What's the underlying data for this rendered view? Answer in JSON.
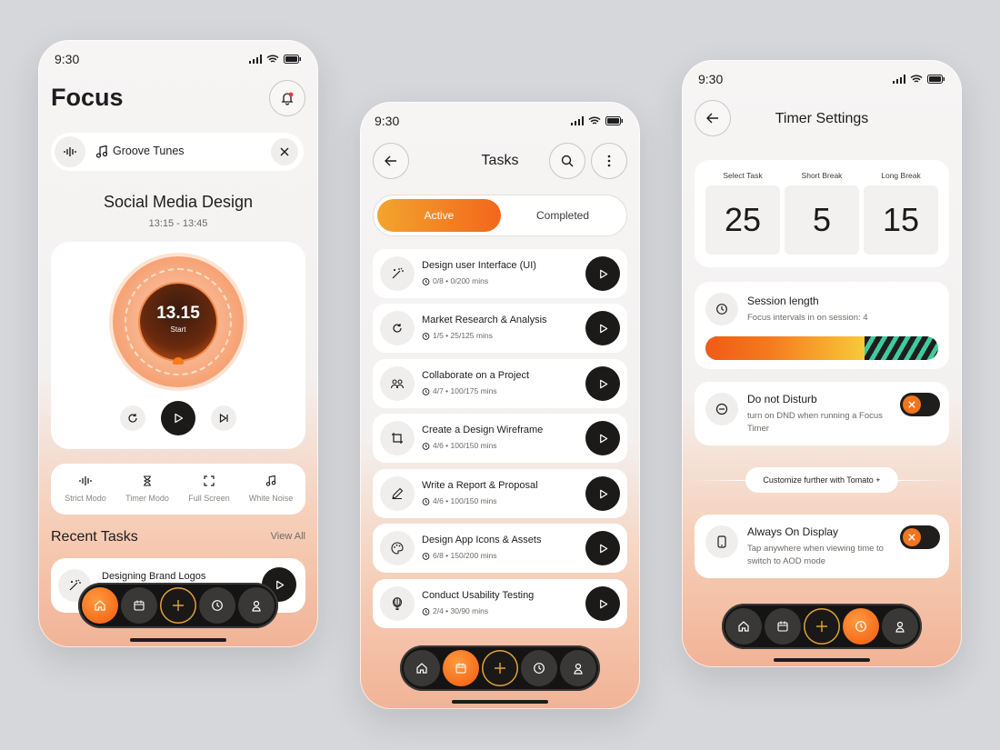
{
  "status_time": "9:30",
  "focus_screen": {
    "title": "Focus",
    "music_label": "Groove Tunes",
    "session_title": "Social Media Design",
    "session_time": "13:15 - 13:45",
    "timer_value": "13.15",
    "timer_caption": "Start",
    "modes": [
      {
        "label": "Strict Modo",
        "icon": "waveform-icon"
      },
      {
        "label": "Timer Modo",
        "icon": "hourglass-icon"
      },
      {
        "label": "Full Screen",
        "icon": "fullscreen-icon"
      },
      {
        "label": "White Noise",
        "icon": "music-note-icon"
      }
    ],
    "recent_title": "Recent Tasks",
    "view_all": "View All",
    "recent_task": "Designing Brand Logos",
    "accent": "#f26b1d"
  },
  "tasks_screen": {
    "title": "Tasks",
    "tab_active": "Active",
    "tab_completed": "Completed",
    "tasks": [
      {
        "name": "Design user Interface (UI)",
        "meta": "0/8 • 0/200 mins",
        "icon": "magic-wand-icon"
      },
      {
        "name": "Market Research & Analysis",
        "meta": "1/5 • 25/125 mins",
        "icon": "refresh-icon"
      },
      {
        "name": "Collaborate on a Project",
        "meta": "4/7 • 100/175 mins",
        "icon": "team-icon"
      },
      {
        "name": "Create a Design Wireframe",
        "meta": "4/6 • 100/150 mins",
        "icon": "crop-icon"
      },
      {
        "name": "Write a Report & Proposal",
        "meta": "4/6 • 100/150 mins",
        "icon": "pen-icon"
      },
      {
        "name": "Design App Icons & Assets",
        "meta": "6/8 • 150/200 mins",
        "icon": "palette-icon"
      },
      {
        "name": "Conduct Usability Testing",
        "meta": "2/4 • 30/90 mins",
        "icon": "balloon-icon"
      }
    ]
  },
  "settings_screen": {
    "title": "Timer Settings",
    "select_task_label": "Select Task",
    "short_break_label": "Short Break",
    "long_break_label": "Long Break",
    "select_task_value": "25",
    "short_break_value": "5",
    "long_break_value": "15",
    "session_title": "Session length",
    "session_sub": "Focus intervals in on session: 4",
    "dnd_title": "Do not Disturb",
    "dnd_sub": "turn on DND when running a Focus Timer",
    "customize_label": "Customize further with Tomato +",
    "aod_title": "Always On Display",
    "aod_sub": "Tap anywhere when viewing time to switch to AOD mode",
    "dnd_toggle": "off",
    "aod_toggle": "off"
  }
}
